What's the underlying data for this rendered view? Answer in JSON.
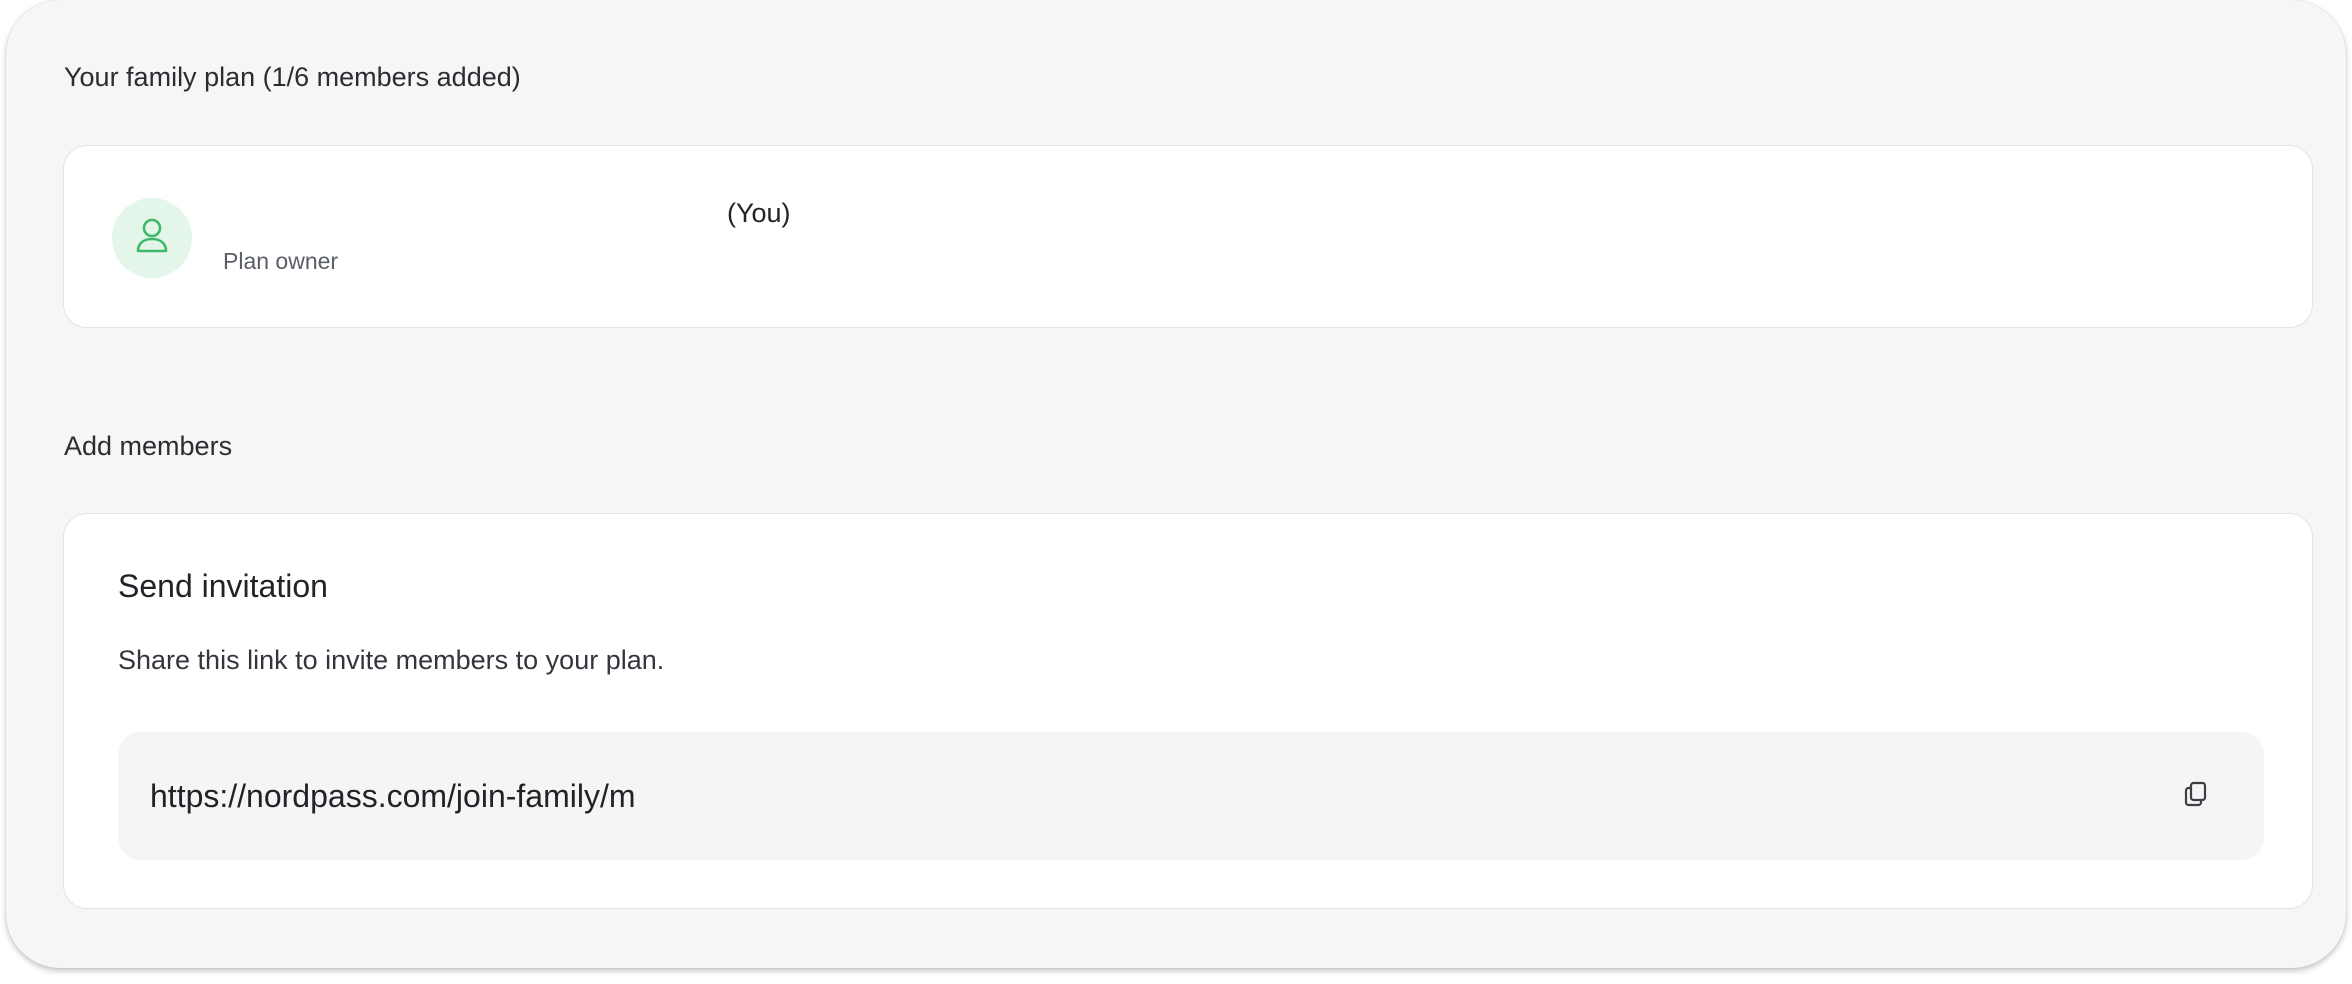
{
  "family_plan": {
    "title": "Your family plan (1/6 members added)",
    "owner": {
      "name_suffix": "(You)",
      "role": "Plan owner",
      "avatar_icon": "user-icon",
      "avatar_bg": "#e4f5ea",
      "avatar_color": "#3fb86c"
    }
  },
  "add_members": {
    "title": "Add members",
    "invitation": {
      "heading": "Send invitation",
      "description": "Share this link to invite members to your plan.",
      "link": "https://nordpass.com/join-family/m",
      "copy_icon": "copy-icon"
    }
  }
}
